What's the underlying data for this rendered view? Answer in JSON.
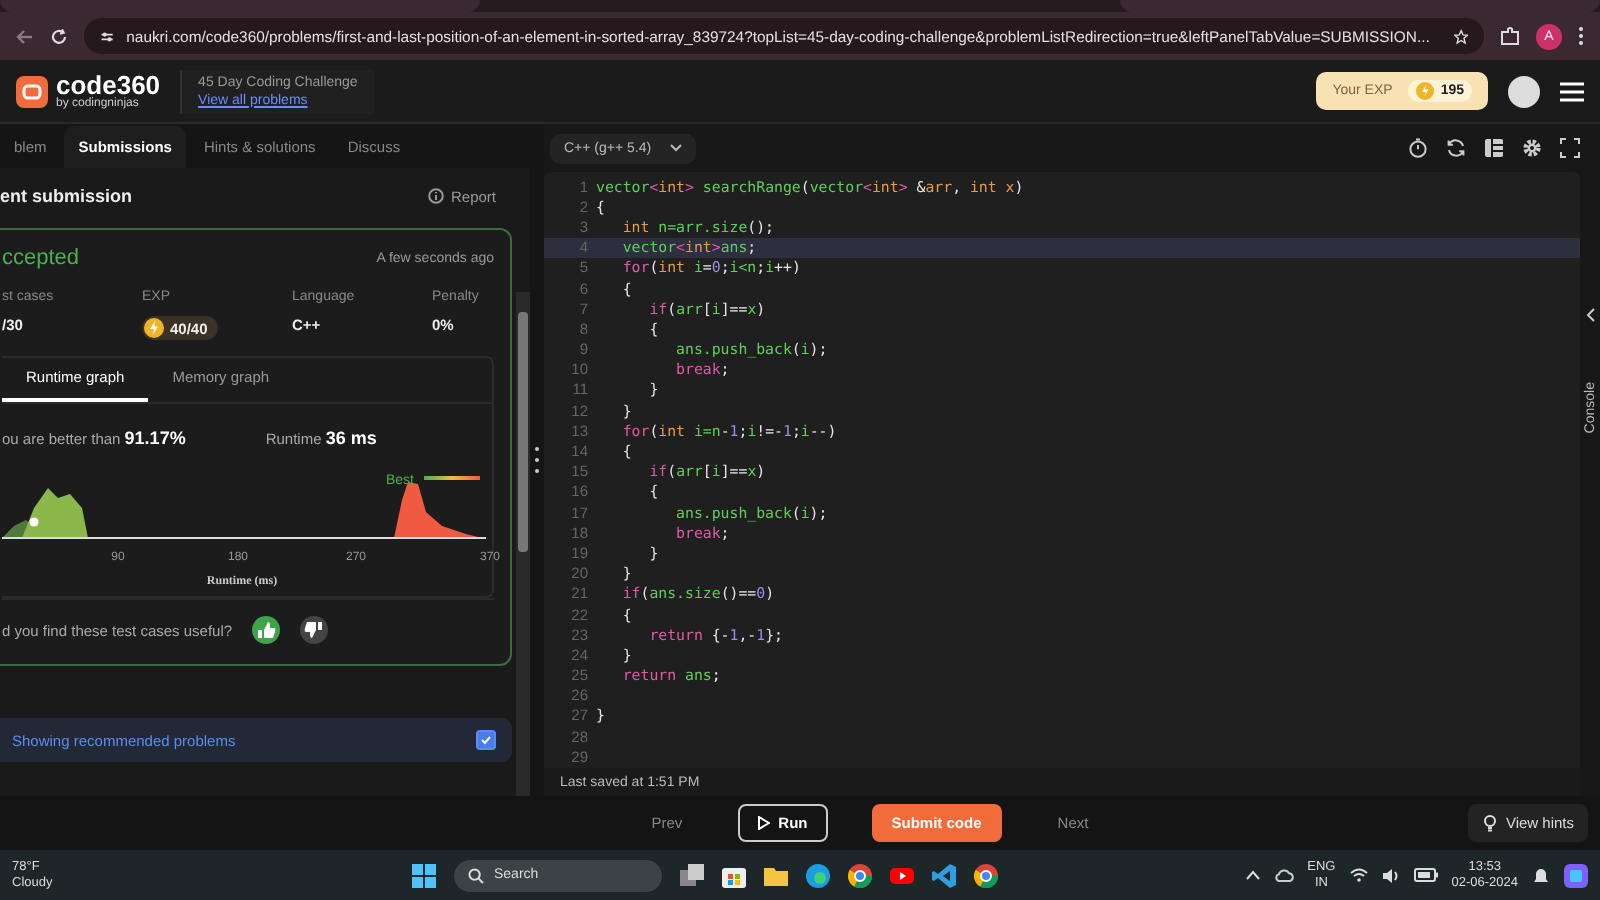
{
  "browser": {
    "url": "naukri.com/code360/problems/first-and-last-position-of-an-element-in-sorted-array_839724?topList=45-day-coding-challenge&problemListRedirection=true&leftPanelTabValue=SUBMISSION...",
    "profile_initial": "A"
  },
  "header": {
    "logo": "code360",
    "logo_tagline": "by codingninjas",
    "challenge_title": "45 Day Coding Challenge",
    "challenge_link": "View all problems",
    "exp_label": "Your EXP",
    "exp_value": "195"
  },
  "left_tabs": [
    {
      "label": "blem",
      "selected": false
    },
    {
      "label": "Submissions",
      "selected": true
    },
    {
      "label": "Hints & solutions",
      "selected": false
    },
    {
      "label": "Discuss",
      "selected": false
    }
  ],
  "submission": {
    "title": "ent submission",
    "report": "Report",
    "status": "ccepted",
    "time": "A few seconds ago",
    "stats": [
      {
        "label": "st cases",
        "value": "/30",
        "kind": "text"
      },
      {
        "label": "EXP",
        "value": "40/40",
        "kind": "exp"
      },
      {
        "label": "Language",
        "value": "C++",
        "kind": "text"
      },
      {
        "label": "Penalty",
        "value": "0%",
        "kind": "text"
      }
    ],
    "graph_tabs": [
      {
        "label": "Runtime graph",
        "selected": true
      },
      {
        "label": "Memory graph",
        "selected": false
      }
    ],
    "better_than": "ou are better than **91.17%**",
    "runtime": "Runtime **36 ms**",
    "graph": {
      "best_label": "Best",
      "xticks": [
        "90",
        "180",
        "270",
        "370"
      ],
      "xlabel": "Runtime (ms)"
    },
    "feedback": "d you find these test cases useful?",
    "votes": [
      {
        "kind": "up",
        "selected": true
      },
      {
        "kind": "down",
        "selected": false
      }
    ]
  },
  "recommended": {
    "label": "Showing recommended problems",
    "checked": true
  },
  "editor": {
    "language": "C++ (g++ 5.4)",
    "console": "Console",
    "last_saved": "Last saved at 1:51 PM",
    "lines": [
      {
        "number": "1",
        "highlighted": false,
        "tokens": [
          {
            "kind": "n",
            "text": "vector"
          },
          {
            "kind": "k",
            "text": "<"
          },
          {
            "kind": "t",
            "text": "int"
          },
          {
            "kind": "k",
            "text": ">"
          },
          {
            "kind": "n",
            "text": " searchRange"
          },
          {
            "kind": "p",
            "text": "("
          },
          {
            "kind": "n",
            "text": "vector"
          },
          {
            "kind": "k",
            "text": "<"
          },
          {
            "kind": "t",
            "text": "int"
          },
          {
            "kind": "k",
            "text": ">"
          },
          {
            "kind": "p",
            "text": " &"
          },
          {
            "kind": "t",
            "text": "arr"
          },
          {
            "kind": "p",
            "text": ", "
          },
          {
            "kind": "t",
            "text": "int"
          },
          {
            "kind": "t",
            "text": " x"
          },
          {
            "kind": "p",
            "text": ")"
          }
        ]
      },
      {
        "number": "2",
        "highlighted": false,
        "tokens": [
          {
            "kind": "p",
            "text": "{"
          }
        ]
      },
      {
        "number": "3",
        "highlighted": false,
        "tokens": [
          {
            "kind": "t",
            "text": "   int"
          },
          {
            "kind": "n",
            "text": " n=arr.size"
          },
          {
            "kind": "p",
            "text": "();"
          }
        ]
      },
      {
        "number": "4",
        "highlighted": true,
        "tokens": [
          {
            "kind": "n",
            "text": "   vector"
          },
          {
            "kind": "k",
            "text": "<"
          },
          {
            "kind": "t",
            "text": "int"
          },
          {
            "kind": "k",
            "text": ">"
          },
          {
            "kind": "n",
            "text": "ans"
          },
          {
            "kind": "p",
            "text": ";"
          }
        ]
      },
      {
        "number": "5",
        "highlighted": false,
        "tokens": [
          {
            "kind": "k",
            "text": "   for"
          },
          {
            "kind": "p",
            "text": "("
          },
          {
            "kind": "t",
            "text": "int"
          },
          {
            "kind": "n",
            "text": " i"
          },
          {
            "kind": "p",
            "text": "="
          },
          {
            "kind": "u",
            "text": "0"
          },
          {
            "kind": "p",
            "text": ";"
          },
          {
            "kind": "n",
            "text": "i<n"
          },
          {
            "kind": "p",
            "text": ";"
          },
          {
            "kind": "n",
            "text": "i"
          },
          {
            "kind": "p",
            "text": "++)"
          }
        ]
      },
      {
        "number": "6",
        "highlighted": false,
        "tokens": [
          {
            "kind": "p",
            "text": "   {"
          }
        ]
      },
      {
        "number": "7",
        "highlighted": false,
        "tokens": [
          {
            "kind": "k",
            "text": "      if"
          },
          {
            "kind": "p",
            "text": "("
          },
          {
            "kind": "n",
            "text": "arr"
          },
          {
            "kind": "p",
            "text": "["
          },
          {
            "kind": "n",
            "text": "i"
          },
          {
            "kind": "p",
            "text": "]=="
          },
          {
            "kind": "n",
            "text": "x"
          },
          {
            "kind": "p",
            "text": ")"
          }
        ]
      },
      {
        "number": "8",
        "highlighted": false,
        "tokens": [
          {
            "kind": "p",
            "text": "      {"
          }
        ]
      },
      {
        "number": "9",
        "highlighted": false,
        "tokens": [
          {
            "kind": "n",
            "text": "         ans.push_back"
          },
          {
            "kind": "p",
            "text": "("
          },
          {
            "kind": "n",
            "text": "i"
          },
          {
            "kind": "p",
            "text": ");"
          }
        ]
      },
      {
        "number": "10",
        "highlighted": false,
        "tokens": [
          {
            "kind": "k",
            "text": "         break"
          },
          {
            "kind": "p",
            "text": ";"
          }
        ]
      },
      {
        "number": "11",
        "highlighted": false,
        "tokens": [
          {
            "kind": "p",
            "text": "      }"
          }
        ]
      },
      {
        "number": "12",
        "highlighted": false,
        "tokens": [
          {
            "kind": "p",
            "text": "   }"
          }
        ]
      },
      {
        "number": "13",
        "highlighted": false,
        "tokens": [
          {
            "kind": "k",
            "text": "   for"
          },
          {
            "kind": "p",
            "text": "("
          },
          {
            "kind": "t",
            "text": "int"
          },
          {
            "kind": "n",
            "text": " i=n"
          },
          {
            "kind": "p",
            "text": "-"
          },
          {
            "kind": "u",
            "text": "1"
          },
          {
            "kind": "p",
            "text": ";"
          },
          {
            "kind": "n",
            "text": "i"
          },
          {
            "kind": "p",
            "text": "!=-"
          },
          {
            "kind": "u",
            "text": "1"
          },
          {
            "kind": "p",
            "text": ";"
          },
          {
            "kind": "n",
            "text": "i"
          },
          {
            "kind": "p",
            "text": "--)"
          }
        ]
      },
      {
        "number": "14",
        "highlighted": false,
        "tokens": [
          {
            "kind": "p",
            "text": "   {"
          }
        ]
      },
      {
        "number": "15",
        "highlighted": false,
        "tokens": [
          {
            "kind": "k",
            "text": "      if"
          },
          {
            "kind": "p",
            "text": "("
          },
          {
            "kind": "n",
            "text": "arr"
          },
          {
            "kind": "p",
            "text": "["
          },
          {
            "kind": "n",
            "text": "i"
          },
          {
            "kind": "p",
            "text": "]=="
          },
          {
            "kind": "n",
            "text": "x"
          },
          {
            "kind": "p",
            "text": ")"
          }
        ]
      },
      {
        "number": "16",
        "highlighted": false,
        "tokens": [
          {
            "kind": "p",
            "text": "      {"
          }
        ]
      },
      {
        "number": "17",
        "highlighted": false,
        "tokens": [
          {
            "kind": "n",
            "text": "         ans.push_back"
          },
          {
            "kind": "p",
            "text": "("
          },
          {
            "kind": "n",
            "text": "i"
          },
          {
            "kind": "p",
            "text": ");"
          }
        ]
      },
      {
        "number": "18",
        "highlighted": false,
        "tokens": [
          {
            "kind": "k",
            "text": "         break"
          },
          {
            "kind": "p",
            "text": ";"
          }
        ]
      },
      {
        "number": "19",
        "highlighted": false,
        "tokens": [
          {
            "kind": "p",
            "text": "      }"
          }
        ]
      },
      {
        "number": "20",
        "highlighted": false,
        "tokens": [
          {
            "kind": "p",
            "text": "   }"
          }
        ]
      },
      {
        "number": "21",
        "highlighted": false,
        "tokens": [
          {
            "kind": "k",
            "text": "   if"
          },
          {
            "kind": "p",
            "text": "("
          },
          {
            "kind": "n",
            "text": "ans.size"
          },
          {
            "kind": "p",
            "text": "()=="
          },
          {
            "kind": "u",
            "text": "0"
          },
          {
            "kind": "p",
            "text": ")"
          }
        ]
      },
      {
        "number": "22",
        "highlighted": false,
        "tokens": [
          {
            "kind": "p",
            "text": "   {"
          }
        ]
      },
      {
        "number": "23",
        "highlighted": false,
        "tokens": [
          {
            "kind": "k",
            "text": "      return"
          },
          {
            "kind": "p",
            "text": " {-"
          },
          {
            "kind": "u",
            "text": "1"
          },
          {
            "kind": "p",
            "text": ",-"
          },
          {
            "kind": "u",
            "text": "1"
          },
          {
            "kind": "p",
            "text": "};"
          }
        ]
      },
      {
        "number": "24",
        "highlighted": false,
        "tokens": [
          {
            "kind": "p",
            "text": "   }"
          }
        ]
      },
      {
        "number": "25",
        "highlighted": false,
        "tokens": [
          {
            "kind": "k",
            "text": "   return"
          },
          {
            "kind": "n",
            "text": " ans"
          },
          {
            "kind": "p",
            "text": ";"
          }
        ]
      },
      {
        "number": "26",
        "highlighted": false
      },
      {
        "number": "27",
        "highlighted": false,
        "tokens": [
          {
            "kind": "p",
            "text": "}"
          }
        ]
      },
      {
        "number": "28",
        "highlighted": false
      },
      {
        "number": "29",
        "highlighted": false
      }
    ]
  },
  "actions": {
    "prev": "Prev",
    "run": "Run",
    "submit": "Submit code",
    "next": "Next",
    "hints": "View hints"
  },
  "taskbar": {
    "temperature": "78°F",
    "weather": "Cloudy",
    "search": "Search",
    "language": "ENG",
    "region": "IN",
    "time": "13:53",
    "date": "02-06-2024"
  }
}
